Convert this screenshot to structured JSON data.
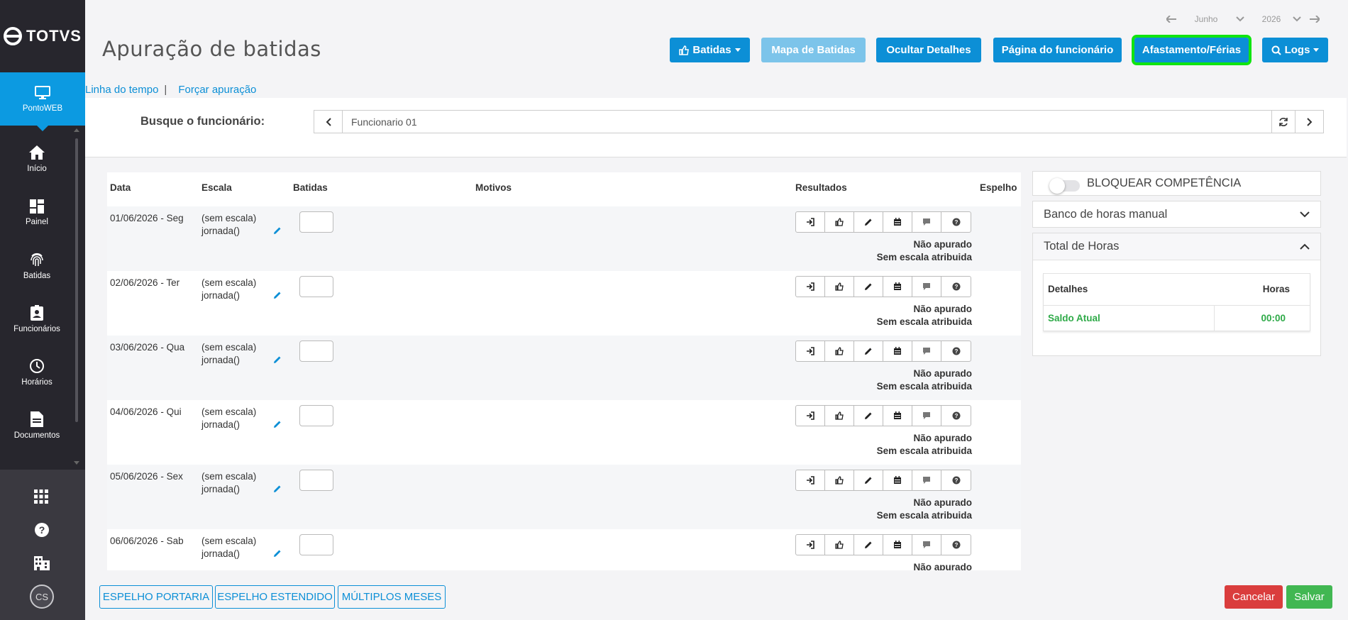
{
  "app": {
    "logo_text": "TOTVS"
  },
  "sidebar": {
    "active": {
      "label": "PontoWEB",
      "icon": "monitor-icon"
    },
    "items": [
      {
        "label": "Início",
        "icon": "home-icon"
      },
      {
        "label": "Painel",
        "icon": "dashboard-icon"
      },
      {
        "label": "Batidas",
        "icon": "fingerprint-icon"
      },
      {
        "label": "Funcionários",
        "icon": "badge-icon"
      },
      {
        "label": "Horários",
        "icon": "clock-icon"
      },
      {
        "label": "Documentos",
        "icon": "document-icon"
      }
    ],
    "avatar_initials": "CS"
  },
  "header": {
    "title": "Apuração de batidas",
    "month": "Junho",
    "year": "2026",
    "buttons": {
      "batidas": "Batidas",
      "mapa": "Mapa de Batidas",
      "ocultar": "Ocultar Detalhes",
      "pagina": "Página do funcionário",
      "afastamento": "Afastamento/Férias",
      "logs": "Logs"
    }
  },
  "links": {
    "timeline": "Linha do tempo",
    "separator": "|",
    "force": "Forçar apuração"
  },
  "search": {
    "label": "Busque o funcionário:",
    "value": "Funcionario 01"
  },
  "table": {
    "headers": {
      "data": "Data",
      "escala": "Escala",
      "batidas": "Batidas",
      "motivos": "Motivos",
      "resultados": "Resultados",
      "espelho": "Espelho"
    },
    "rows": [
      {
        "date": "01/06/2026 - Seg",
        "escala1": "(sem escala)",
        "escala2": "jornada()",
        "status1": "Não apurado",
        "status2": "Sem escala atribuida"
      },
      {
        "date": "02/06/2026 - Ter",
        "escala1": "(sem escala)",
        "escala2": "jornada()",
        "status1": "Não apurado",
        "status2": "Sem escala atribuida"
      },
      {
        "date": "03/06/2026 - Qua",
        "escala1": "(sem escala)",
        "escala2": "jornada()",
        "status1": "Não apurado",
        "status2": "Sem escala atribuida"
      },
      {
        "date": "04/06/2026 - Qui",
        "escala1": "(sem escala)",
        "escala2": "jornada()",
        "status1": "Não apurado",
        "status2": "Sem escala atribuida"
      },
      {
        "date": "05/06/2026 - Sex",
        "escala1": "(sem escala)",
        "escala2": "jornada()",
        "status1": "Não apurado",
        "status2": "Sem escala atribuida"
      },
      {
        "date": "06/06/2026 - Sab",
        "escala1": "(sem escala)",
        "escala2": "jornada()",
        "status1": "Não apurado",
        "status2": ""
      }
    ]
  },
  "panel": {
    "lock_label": "BLOQUEAR COMPETÊNCIA",
    "lock_enabled": false,
    "bank_label": "Banco de horas manual",
    "total_label": "Total de Horas",
    "col_details": "Detalhes",
    "col_hours": "Horas",
    "saldo_label": "Saldo Atual",
    "saldo_value": "00:00",
    "saldo_color": "#2eaa48"
  },
  "footer": {
    "portaria": "ESPELHO PORTARIA",
    "estendido": "ESPELHO ESTENDIDO",
    "multiplos": "MÚLTIPLOS MESES",
    "cancel": "Cancelar",
    "save": "Salvar"
  },
  "colors": {
    "primary": "#0c8fd6",
    "sidebar": "#27262d",
    "active": "#0c9ae1",
    "highlight": "#10e510",
    "danger": "#da3d3d",
    "success": "#41b752"
  }
}
